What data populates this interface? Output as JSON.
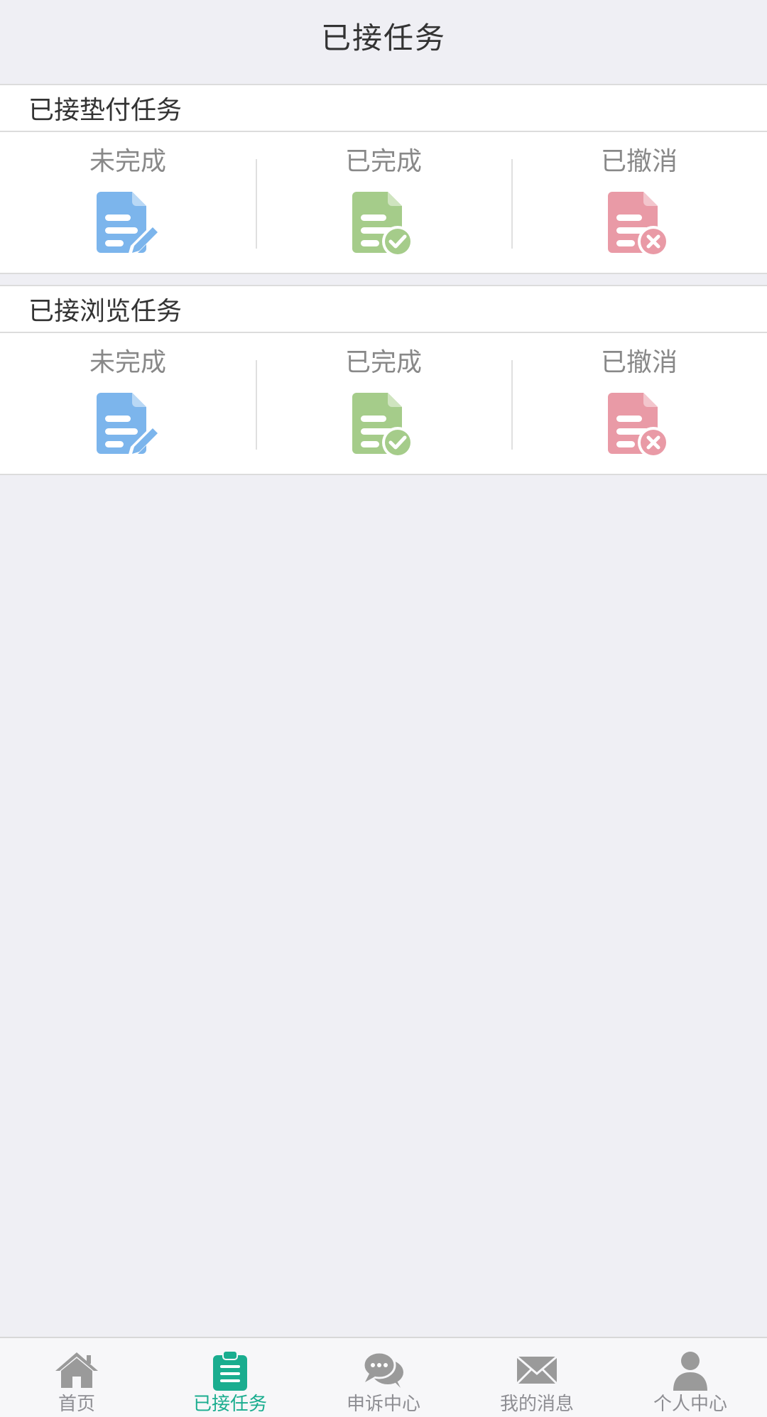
{
  "header": {
    "title": "已接任务"
  },
  "sections": [
    {
      "title": "已接垫付任务",
      "items": [
        {
          "label": "未完成",
          "icon": "document-edit-icon",
          "color": "#7cb5ec"
        },
        {
          "label": "已完成",
          "icon": "document-check-icon",
          "color": "#a5cc8a"
        },
        {
          "label": "已撤消",
          "icon": "document-cancel-icon",
          "color": "#e99aa6"
        }
      ]
    },
    {
      "title": "已接浏览任务",
      "items": [
        {
          "label": "未完成",
          "icon": "document-edit-icon",
          "color": "#7cb5ec"
        },
        {
          "label": "已完成",
          "icon": "document-check-icon",
          "color": "#a5cc8a"
        },
        {
          "label": "已撤消",
          "icon": "document-cancel-icon",
          "color": "#e99aa6"
        }
      ]
    }
  ],
  "tabbar": {
    "active_color": "#1aad8f",
    "inactive_color": "#9a9a9a",
    "items": [
      {
        "label": "首页",
        "icon": "home-icon",
        "active": false
      },
      {
        "label": "已接任务",
        "icon": "clipboard-icon",
        "active": true
      },
      {
        "label": "申诉中心",
        "icon": "chat-icon",
        "active": false
      },
      {
        "label": "我的消息",
        "icon": "mail-icon",
        "active": false
      },
      {
        "label": "个人中心",
        "icon": "user-icon",
        "active": false
      }
    ]
  }
}
